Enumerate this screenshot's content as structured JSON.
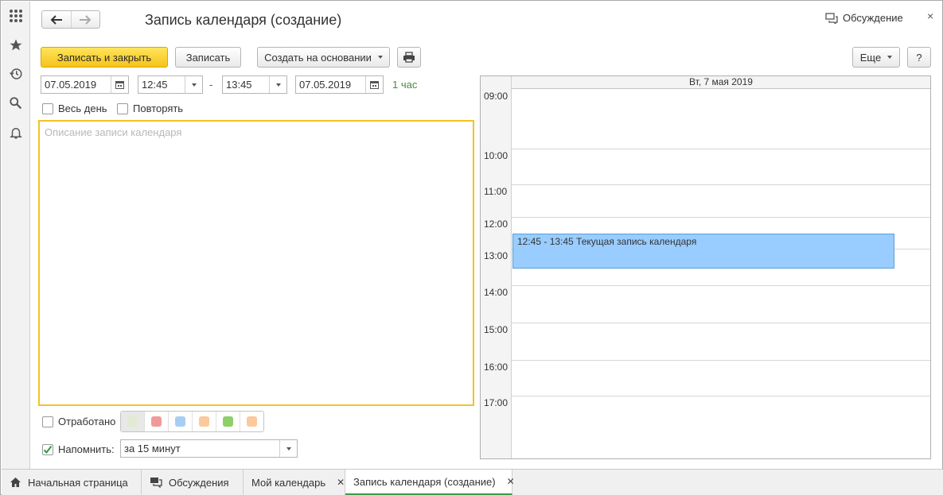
{
  "window": {
    "title": "Запись календаря (создание)",
    "discussion_label": "Обсуждение",
    "close_glyph": "×"
  },
  "toolbar": {
    "save_close_label": "Записать и закрыть",
    "save_label": "Записать",
    "create_based_label": "Создать на основании",
    "more_label": "Еще",
    "help_label": "?"
  },
  "schedule": {
    "start_date": "07.05.2019",
    "start_time": "12:45",
    "separator": "-",
    "end_time": "13:45",
    "end_date": "07.05.2019",
    "duration": "1 час"
  },
  "options": {
    "all_day_label": "Весь день",
    "all_day_checked": false,
    "repeat_label": "Повторять",
    "repeat_checked": false
  },
  "description": {
    "value": "",
    "placeholder": "Описание записи календаря"
  },
  "worked": {
    "label": "Отработано",
    "checked": false
  },
  "colors": [
    {
      "name": "none",
      "hex": "#e3ead3",
      "selected": true
    },
    {
      "name": "red",
      "hex": "#f29a9a",
      "selected": false
    },
    {
      "name": "blue",
      "hex": "#a9cdf2",
      "selected": false
    },
    {
      "name": "orange",
      "hex": "#fbc99b",
      "selected": false
    },
    {
      "name": "green",
      "hex": "#8fcf6a",
      "selected": false
    },
    {
      "name": "peach",
      "hex": "#fbc99b",
      "selected": false
    }
  ],
  "reminder": {
    "label": "Напомнить:",
    "checked": true,
    "value": "за 15 минут"
  },
  "calendar": {
    "day_header": "Вт, 7 мая 2019",
    "hours": [
      "09:00",
      "10:00",
      "11:00",
      "12:00",
      "13:00",
      "14:00",
      "15:00",
      "16:00",
      "17:00"
    ],
    "event_text": "12:45 - 13:45 Текущая запись календаря",
    "event_color": "#99ccff"
  },
  "tabs": [
    {
      "label": "Начальная страница",
      "icon": "home-icon",
      "closable": false,
      "active": false
    },
    {
      "label": "Обсуждения",
      "icon": "discussions-icon",
      "closable": false,
      "active": false
    },
    {
      "label": "Мой календарь",
      "icon": "",
      "closable": true,
      "active": false
    },
    {
      "label": "Запись календаря (создание)",
      "icon": "",
      "closable": true,
      "active": true
    }
  ],
  "icons": {
    "rail": [
      "apps-grid-icon",
      "star-icon",
      "history-icon",
      "search-icon",
      "bell-icon"
    ],
    "nav": [
      "arrow-left-icon",
      "arrow-right-icon"
    ],
    "print": "printer-icon",
    "calendar_picker": "calendar-picker-icon",
    "dropdown": "chevron-down-icon"
  }
}
